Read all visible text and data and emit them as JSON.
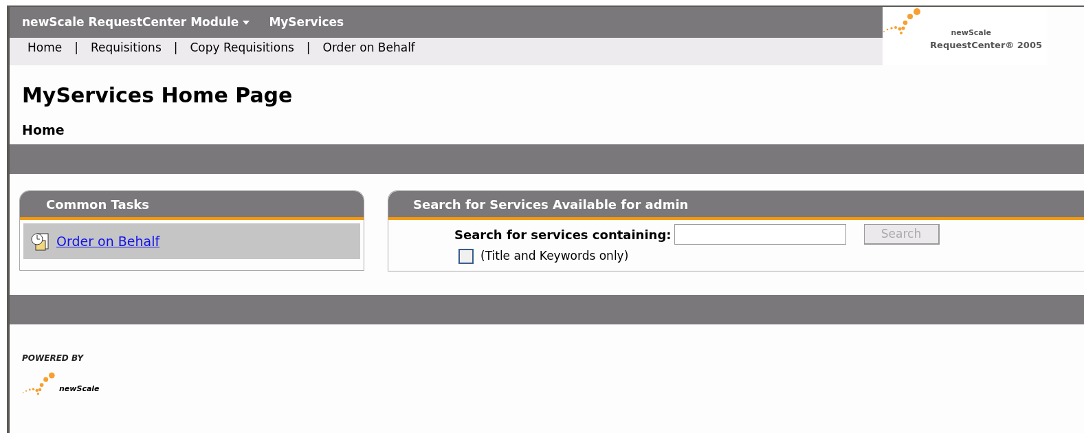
{
  "header": {
    "module_menu": "newScale RequestCenter Module",
    "section": "MyServices",
    "nav": [
      "Home",
      "Requisitions",
      "Copy Requisitions",
      "Order on Behalf"
    ],
    "nav_separator": "|",
    "logo": {
      "brand": "newScale",
      "product": "RequestCenter® 2005"
    }
  },
  "page_title": "MyServices Home Page",
  "breadcrumb": "Home",
  "common_tasks": {
    "title": "Common Tasks",
    "items": [
      {
        "label": "Order on Behalf"
      }
    ]
  },
  "search_panel": {
    "title": "Search for Services Available for admin",
    "label": "Search for services containing:",
    "button": "Search",
    "button_disabled": true,
    "checkbox": {
      "label": "(Title and Keywords only)",
      "checked": false
    }
  },
  "footer": {
    "powered_by": "POWERED BY",
    "brand": "newScale"
  }
}
